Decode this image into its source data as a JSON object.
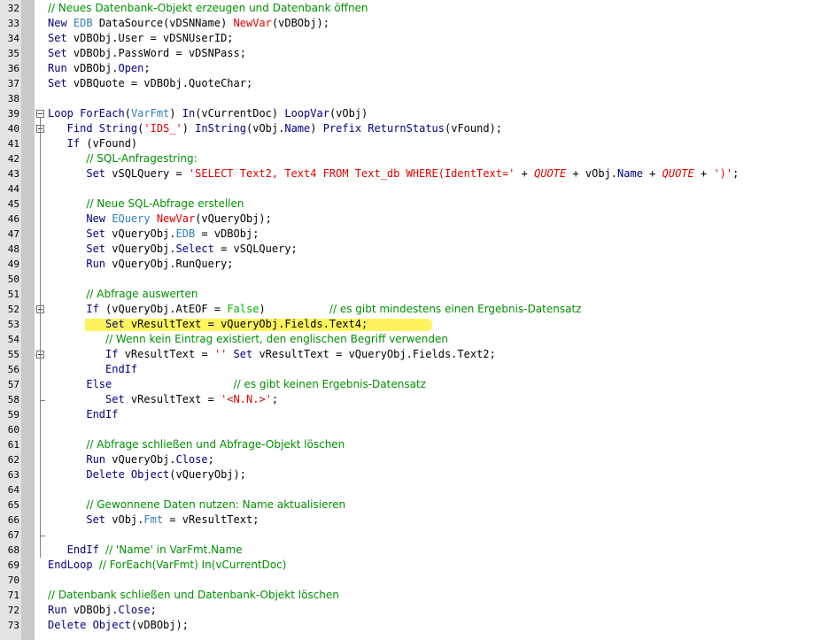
{
  "editor": {
    "line_numbers": [
      "32",
      "33",
      "34",
      "35",
      "36",
      "37",
      "38",
      "39",
      "40",
      "41",
      "42",
      "43",
      "44",
      "45",
      "46",
      "47",
      "48",
      "49",
      "50",
      "51",
      "52",
      "53",
      "54",
      "55",
      "56",
      "57",
      "58",
      "59",
      "60",
      "61",
      "62",
      "63",
      "64",
      "65",
      "66",
      "67",
      "68",
      "69",
      "70",
      "71",
      "72",
      "73"
    ],
    "lines": [
      {
        "n": "32",
        "parts": [
          [
            "cm",
            "// Neues Datenbank-Objekt erzeugen und Datenbank öffnen"
          ]
        ]
      },
      {
        "n": "33",
        "parts": [
          [
            "kw",
            "New "
          ],
          [
            "ty",
            "EDB "
          ],
          [
            "pl",
            "DataSource(vDSNName) "
          ],
          [
            "nv",
            "NewVar"
          ],
          [
            "pl",
            "(vDBObj);"
          ]
        ]
      },
      {
        "n": "34",
        "parts": [
          [
            "kw",
            "Set "
          ],
          [
            "pl",
            "vDBObj.User = vDSNUserID;"
          ]
        ]
      },
      {
        "n": "35",
        "parts": [
          [
            "kw",
            "Set "
          ],
          [
            "pl",
            "vDBObj.PassWord = vDSNPass;"
          ]
        ]
      },
      {
        "n": "36",
        "parts": [
          [
            "kw",
            "Run "
          ],
          [
            "pl",
            "vDBObj."
          ],
          [
            "kw",
            "Open"
          ],
          [
            "pl",
            ";"
          ]
        ]
      },
      {
        "n": "37",
        "parts": [
          [
            "kw",
            "Set "
          ],
          [
            "pl",
            "vDBQuote = vDBObj.QuoteChar;"
          ]
        ]
      },
      {
        "n": "38",
        "parts": []
      },
      {
        "n": "39",
        "parts": [
          [
            "kw",
            "Loop ForEach"
          ],
          [
            "pl",
            "("
          ],
          [
            "ty",
            "VarFmt"
          ],
          [
            "pl",
            ") "
          ],
          [
            "kw",
            "In"
          ],
          [
            "pl",
            "(vCurrentDoc) "
          ],
          [
            "kw",
            "LoopVar"
          ],
          [
            "pl",
            "(vObj)"
          ]
        ]
      },
      {
        "n": "40",
        "parts": [
          [
            "kw",
            "   Find String"
          ],
          [
            "pl",
            "("
          ],
          [
            "str",
            "'IDS_'"
          ],
          [
            "pl",
            ") "
          ],
          [
            "kw",
            "InString"
          ],
          [
            "pl",
            "(vObj."
          ],
          [
            "kw",
            "Name"
          ],
          [
            "pl",
            ") "
          ],
          [
            "kw",
            "Prefix ReturnStatus"
          ],
          [
            "pl",
            "(vFound);"
          ]
        ]
      },
      {
        "n": "41",
        "parts": [
          [
            "kw",
            "   If "
          ],
          [
            "pl",
            "(vFound)"
          ]
        ]
      },
      {
        "n": "42",
        "parts": [
          [
            "pl",
            "      "
          ],
          [
            "cm",
            "// SQL-Anfragestring:"
          ]
        ]
      },
      {
        "n": "43",
        "parts": [
          [
            "kw",
            "      Set "
          ],
          [
            "pl",
            "vSQLQuery = "
          ],
          [
            "str",
            "'SELECT Text2, Text4 FROM Text_db WHERE(IdentText='"
          ],
          [
            "pl",
            " + "
          ],
          [
            "q",
            "QUOTE"
          ],
          [
            "pl",
            " + vObj."
          ],
          [
            "kw",
            "Name"
          ],
          [
            "pl",
            " + "
          ],
          [
            "q",
            "QUOTE"
          ],
          [
            "pl",
            " + "
          ],
          [
            "str",
            "')'"
          ],
          [
            "pl",
            ";"
          ]
        ]
      },
      {
        "n": "44",
        "parts": []
      },
      {
        "n": "45",
        "parts": [
          [
            "pl",
            "      "
          ],
          [
            "cm",
            "// Neue SQL-Abfrage erstellen"
          ]
        ]
      },
      {
        "n": "46",
        "parts": [
          [
            "kw",
            "      New "
          ],
          [
            "ty",
            "EQuery "
          ],
          [
            "nv",
            "NewVar"
          ],
          [
            "pl",
            "(vQueryObj);"
          ]
        ]
      },
      {
        "n": "47",
        "parts": [
          [
            "kw",
            "      Set "
          ],
          [
            "pl",
            "vQueryObj."
          ],
          [
            "ty",
            "EDB"
          ],
          [
            "pl",
            " = vDBObj;"
          ]
        ]
      },
      {
        "n": "48",
        "parts": [
          [
            "kw",
            "      Set "
          ],
          [
            "pl",
            "vQueryObj."
          ],
          [
            "kw",
            "Select"
          ],
          [
            "pl",
            " = vSQLQuery;"
          ]
        ]
      },
      {
        "n": "49",
        "parts": [
          [
            "kw",
            "      Run "
          ],
          [
            "pl",
            "vQueryObj.RunQuery;"
          ]
        ]
      },
      {
        "n": "50",
        "parts": []
      },
      {
        "n": "51",
        "parts": [
          [
            "pl",
            "      "
          ],
          [
            "cm",
            "// Abfrage auswerten"
          ]
        ]
      },
      {
        "n": "52",
        "parts": [
          [
            "kw",
            "      If "
          ],
          [
            "pl",
            "(vQueryObj.AtEOF = "
          ],
          [
            "bool",
            "False"
          ],
          [
            "pl",
            ")          "
          ],
          [
            "cm",
            "// es gibt mindestens einen Ergebnis-Datensatz"
          ]
        ]
      },
      {
        "n": "53",
        "parts": [
          [
            "kw",
            "         Set "
          ],
          [
            "pl",
            "vResultText = vQueryObj.Fields.Text4;"
          ]
        ]
      },
      {
        "n": "54",
        "parts": [
          [
            "pl",
            "         "
          ],
          [
            "cm",
            "// Wenn kein Eintrag existiert, den englischen Begriff verwenden"
          ]
        ]
      },
      {
        "n": "55",
        "parts": [
          [
            "kw",
            "         If "
          ],
          [
            "pl",
            "vResultText = "
          ],
          [
            "str",
            "''"
          ],
          [
            "kw",
            " Set "
          ],
          [
            "pl",
            "vResultText = vQueryObj.Fields.Text2;"
          ]
        ]
      },
      {
        "n": "56",
        "parts": [
          [
            "kw",
            "         EndIf"
          ]
        ]
      },
      {
        "n": "57",
        "parts": [
          [
            "kw",
            "      Else"
          ],
          [
            "pl",
            "                   "
          ],
          [
            "cm",
            "// es gibt keinen Ergebnis-Datensatz"
          ]
        ]
      },
      {
        "n": "58",
        "parts": [
          [
            "kw",
            "         Set "
          ],
          [
            "pl",
            "vResultText = "
          ],
          [
            "str",
            "'<N.N.>'"
          ],
          [
            "pl",
            ";"
          ]
        ]
      },
      {
        "n": "59",
        "parts": [
          [
            "kw",
            "      EndIf"
          ]
        ]
      },
      {
        "n": "60",
        "parts": []
      },
      {
        "n": "61",
        "parts": [
          [
            "pl",
            "      "
          ],
          [
            "cm",
            "// Abfrage schließen und Abfrage-Objekt löschen"
          ]
        ]
      },
      {
        "n": "62",
        "parts": [
          [
            "kw",
            "      Run "
          ],
          [
            "pl",
            "vQueryObj."
          ],
          [
            "kw",
            "Close"
          ],
          [
            "pl",
            ";"
          ]
        ]
      },
      {
        "n": "63",
        "parts": [
          [
            "kw",
            "      Delete Object"
          ],
          [
            "pl",
            "(vQueryObj);"
          ]
        ]
      },
      {
        "n": "64",
        "parts": []
      },
      {
        "n": "65",
        "parts": [
          [
            "pl",
            "      "
          ],
          [
            "cm",
            "// Gewonnene Daten nutzen: Name aktualisieren"
          ]
        ]
      },
      {
        "n": "66",
        "parts": [
          [
            "kw",
            "      Set "
          ],
          [
            "pl",
            "vObj."
          ],
          [
            "ty",
            "Fmt"
          ],
          [
            "pl",
            " = vResultText;"
          ]
        ]
      },
      {
        "n": "67",
        "parts": []
      },
      {
        "n": "68",
        "parts": [
          [
            "kw",
            "   EndIf "
          ],
          [
            "cm",
            "// 'Name' in VarFmt.Name"
          ]
        ]
      },
      {
        "n": "69",
        "parts": [
          [
            "kw",
            "EndLoop "
          ],
          [
            "cm",
            "// ForEach(VarFmt) In(vCurrentDoc)"
          ]
        ]
      },
      {
        "n": "70",
        "parts": []
      },
      {
        "n": "71",
        "parts": [
          [
            "cm",
            "// Datenbank schließen und Datenbank-Objekt löschen"
          ]
        ]
      },
      {
        "n": "72",
        "parts": [
          [
            "kw",
            "Run "
          ],
          [
            "pl",
            "vDBObj."
          ],
          [
            "kw",
            "Close"
          ],
          [
            "pl",
            ";"
          ]
        ]
      },
      {
        "n": "73",
        "parts": [
          [
            "kw",
            "Delete Object"
          ],
          [
            "pl",
            "(vDBObj);"
          ]
        ]
      }
    ],
    "highlighted_line": "53",
    "colors": {
      "keyword": "#000080",
      "type": "#2b7fbf",
      "newvar": "#e00000",
      "string": "#e00000",
      "comment": "#009000",
      "boolean": "#00b800",
      "highlight": "#fff028"
    }
  }
}
